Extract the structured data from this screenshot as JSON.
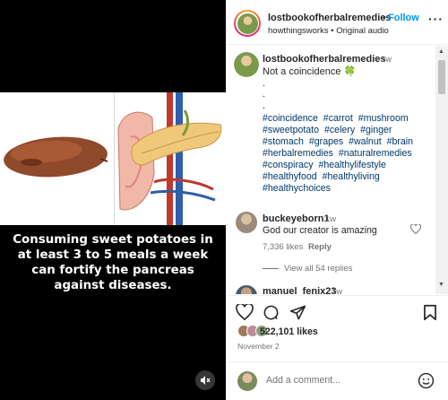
{
  "media": {
    "caption": "Consuming sweet potatoes in at least 3 to 5 meals a week can fortify the pancreas against diseases.",
    "sound_icon": "speaker-muted-icon"
  },
  "header": {
    "username": "lostbookofherbalremedies",
    "separator": "•",
    "follow_label": "Follow",
    "subtitle": "howthingsworks • Original audio",
    "more_icon": "more-options-icon"
  },
  "caption": {
    "username": "lostbookofherbalremedies",
    "time": "1w",
    "text": "Not a coincidence 🍀\n.\n.\n.",
    "hashtags": [
      "#coincidence",
      "#carrot",
      "#mushroom",
      "#sweetpotato",
      "#celery",
      "#ginger",
      "#stomach",
      "#grapes",
      "#walnut",
      "#brain",
      "#herbalremedies",
      "#naturalremedies",
      "#conspiracy",
      "#healthylifestyle",
      "#healthyfood",
      "#healthyliving",
      "#healthychoices"
    ]
  },
  "comments": [
    {
      "username": "buckeyeborn1",
      "time": "1w",
      "text": "God our creator is amazing",
      "likes": "7,336 likes",
      "reply_label": "Reply",
      "view_replies": "View all 54 replies"
    },
    {
      "username": "manuel_fenix23",
      "time": "1w"
    }
  ],
  "actions": {
    "like_icon": "heart-icon",
    "comment_icon": "comment-icon",
    "share_icon": "share-icon",
    "save_icon": "bookmark-icon"
  },
  "likes": {
    "count_text": "522,101 likes"
  },
  "post_date": "November 2",
  "add_comment": {
    "placeholder": "Add a comment...",
    "emoji_icon": "emoji-icon"
  },
  "colors": {
    "link_blue": "#0095f6",
    "hashtag": "#00376b",
    "muted": "#737373"
  }
}
